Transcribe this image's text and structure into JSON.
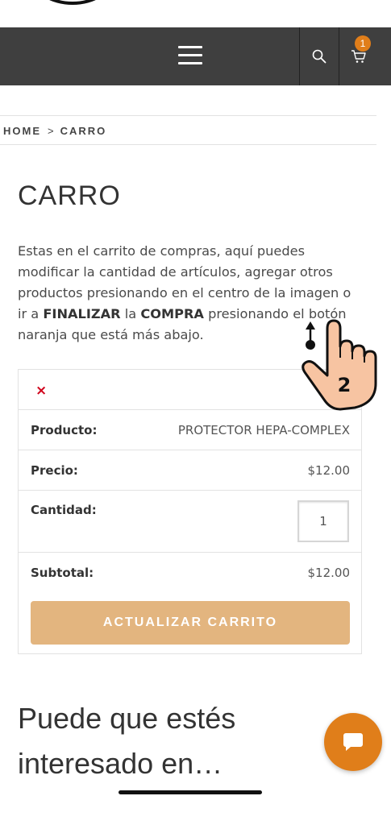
{
  "header": {
    "cart_count": "1",
    "icons": [
      "menu-icon",
      "search-icon",
      "cart-icon"
    ]
  },
  "breadcrumb": {
    "home": "HOME",
    "separator": ">",
    "current": "CARRO"
  },
  "page": {
    "title": "CARRO",
    "intro": {
      "part1": "Estas en el carrito de compras, aquí puedes modificar la cantidad de artículos, agregar otros productos presionando en el centro de la imagen o ir a ",
      "bold1": "FINALIZAR",
      "part2": " la ",
      "bold2": "COMPRA",
      "part3": " presionando el botón naranja que está más abajo."
    }
  },
  "cart": {
    "remove_symbol": "×",
    "rows": [
      {
        "label": "Producto:",
        "value": "PROTECTOR HEPA-COMPLEX"
      },
      {
        "label": "Precio:",
        "value": "$12.00"
      },
      {
        "label": "Cantidad:",
        "value": "1"
      },
      {
        "label": "Subtotal:",
        "value": "$12.00"
      }
    ],
    "update_button": "ACTUALIZAR CARRITO"
  },
  "related": {
    "title": "Puede que estés interesado en…"
  },
  "overlay": {
    "gesture_step": "2"
  },
  "colors": {
    "navbar": "#3f3f3f",
    "accent_orange": "#e07e1a",
    "update_button": "#e3b57f",
    "remove_red": "#d0021b"
  }
}
